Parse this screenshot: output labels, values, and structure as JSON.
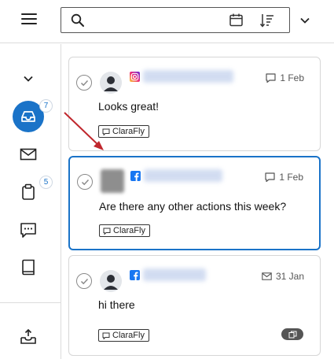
{
  "search": {
    "placeholder": "",
    "value": ""
  },
  "sidebar": {
    "items": [
      {
        "name": "collapse",
        "icon": "chevron-down-icon"
      },
      {
        "name": "inbox",
        "icon": "inbox-icon",
        "badge": "7",
        "active": true
      },
      {
        "name": "mail",
        "icon": "envelope-icon"
      },
      {
        "name": "tasks",
        "icon": "clipboard-icon",
        "badge": "5"
      },
      {
        "name": "chat",
        "icon": "chat-bubble-icon"
      },
      {
        "name": "book",
        "icon": "book-icon"
      },
      {
        "name": "outbox",
        "icon": "outbox-icon"
      }
    ]
  },
  "cards": [
    {
      "network": "instagram",
      "date": "1 Feb",
      "date_icon": "comment-icon",
      "message": "Looks great!",
      "tag": "ClaraFly",
      "selected": false
    },
    {
      "network": "facebook",
      "date": "1 Feb",
      "date_icon": "comment-icon",
      "message": "Are there any other actions this week?",
      "tag": "ClaraFly",
      "selected": true
    },
    {
      "network": "facebook",
      "date": "31 Jan",
      "date_icon": "envelope-icon",
      "message": "hi there",
      "tag": "ClaraFly",
      "selected": false,
      "duplicate_icon": "copy-icon"
    }
  ],
  "colors": {
    "accent": "#1a73c8",
    "facebook": "#1877f2",
    "annotation_arrow": "#c0272d"
  }
}
